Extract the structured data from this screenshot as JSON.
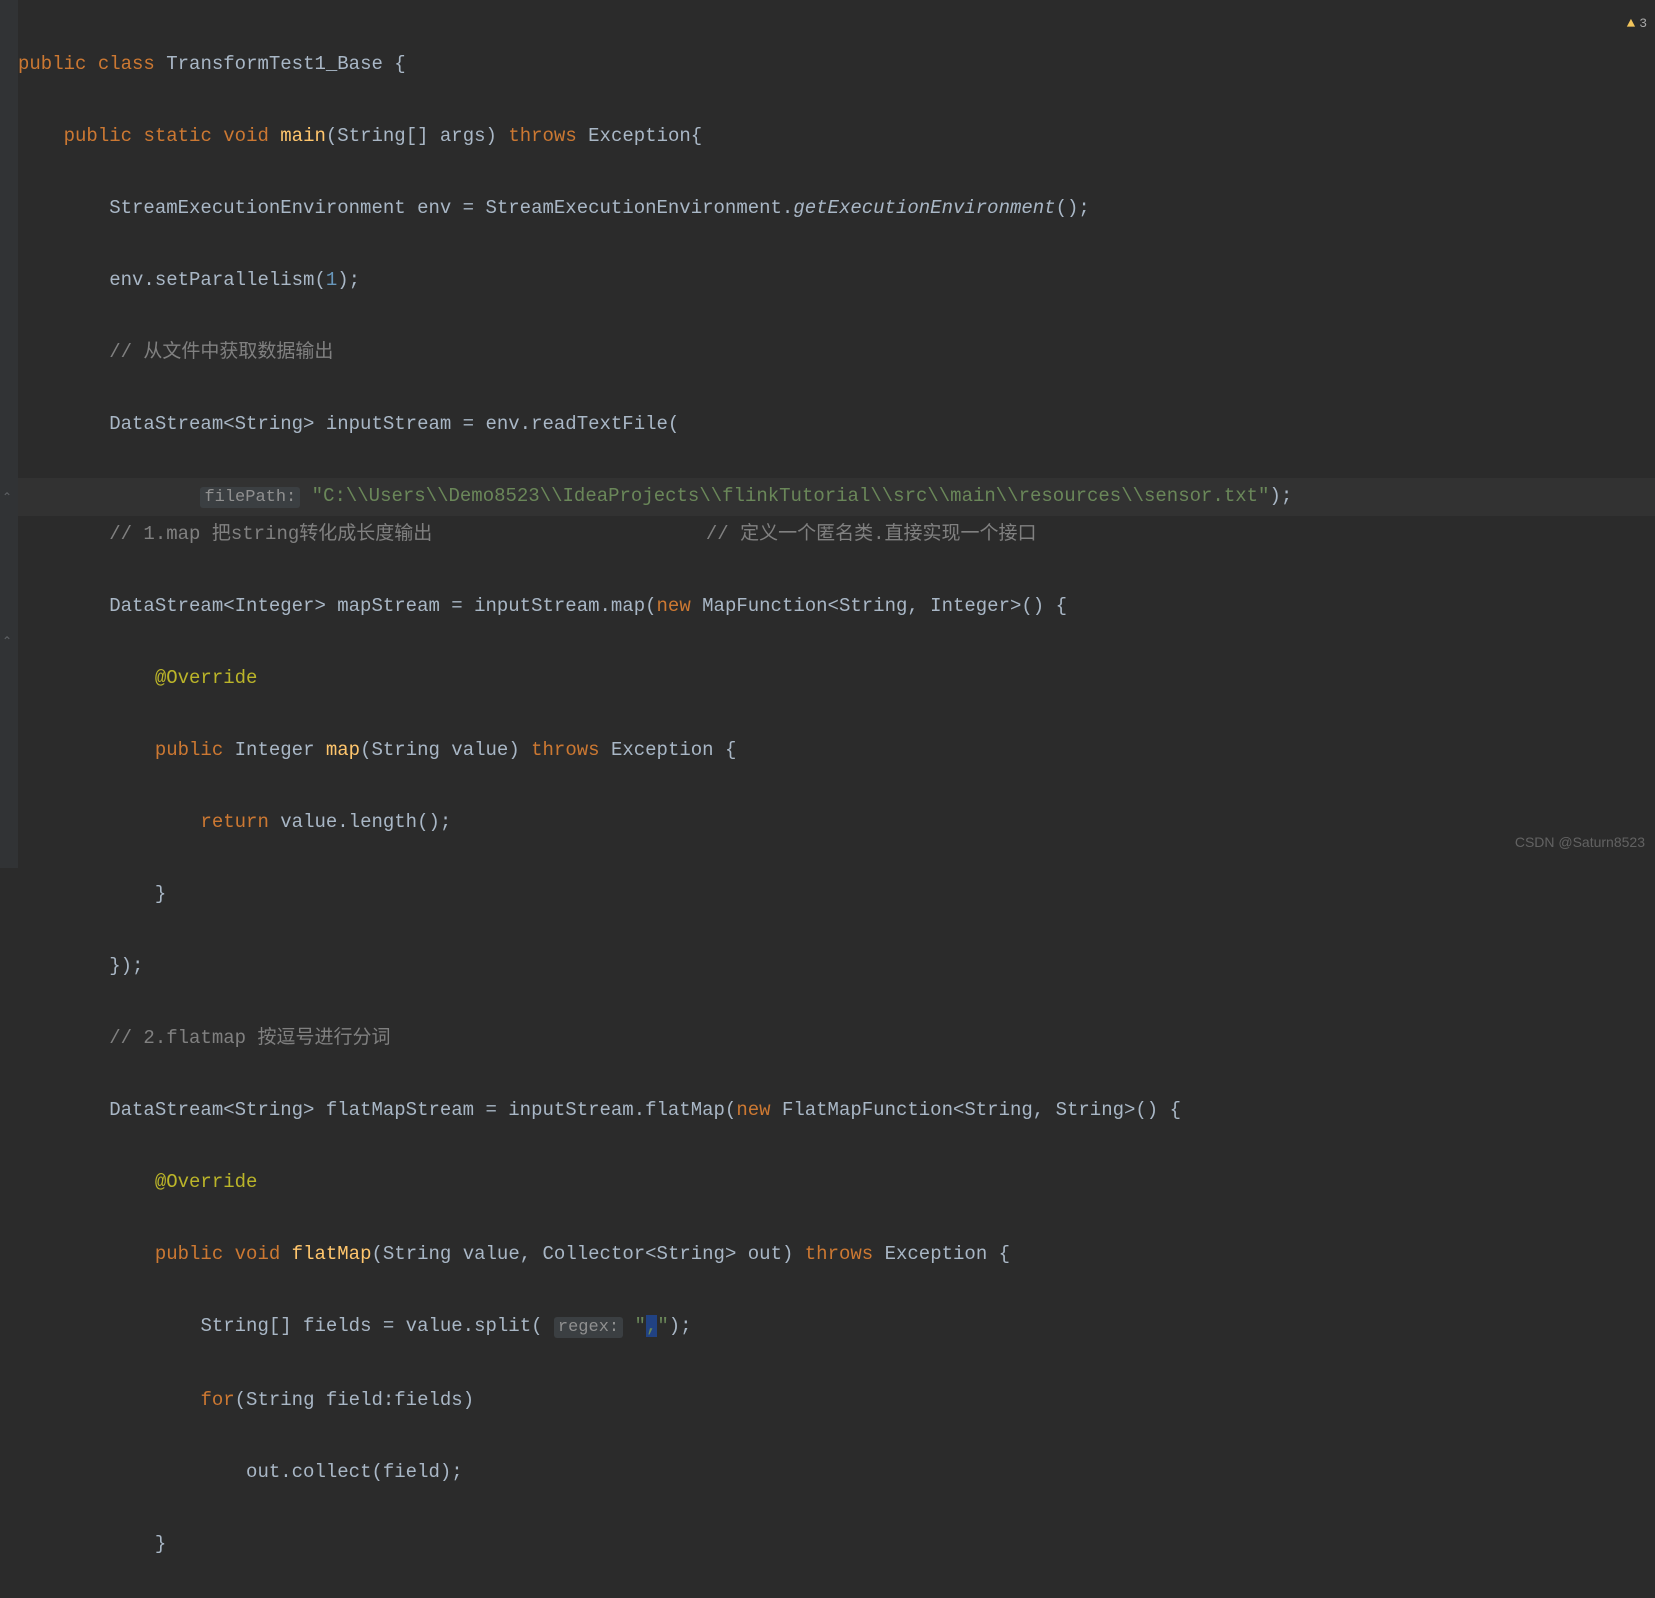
{
  "warnings": {
    "count": "3"
  },
  "watermark": "CSDN @Saturn8523",
  "code": {
    "l1": {
      "kw1": "public",
      "kw2": "class",
      "name": "TransformTest1_Base",
      "brace": "{"
    },
    "l2": {
      "kw1": "public",
      "kw2": "static",
      "kw3": "void",
      "fn": "main",
      "params": "(String[] args)",
      "kw4": "throws",
      "exc": "Exception{"
    },
    "l3": {
      "t1": "StreamExecutionEnvironment env = StreamExecutionEnvironment.",
      "italic": "getExecutionEnvironment",
      "t2": "();"
    },
    "l4": {
      "t1": "env.setParallelism(",
      "num": "1",
      "t2": ");"
    },
    "l5": {
      "c": "// 从文件中获取数据输出"
    },
    "l6": {
      "t": "DataStream<String> inputStream = env.readTextFile("
    },
    "l7": {
      "hint": "filePath:",
      "str": "\"C:\\\\Users\\\\Demo8523\\\\IdeaProjects\\\\flinkTutorial\\\\src\\\\main\\\\resources\\\\sensor.txt\"",
      "end": ");"
    },
    "l8": {
      "c1": "// 1.map 把string转化成长度输出",
      "c2": "// 定义一个匿名类.直接实现一个接口"
    },
    "l9": {
      "t1": "DataStream<Integer> mapStream = inputStream.map(",
      "kw": "new",
      "t2": " MapFunction<String, Integer>() {"
    },
    "l10": {
      "ann": "@Override"
    },
    "l11": {
      "kw1": "public",
      "t1": " Integer ",
      "fn": "map",
      "t2": "(String value) ",
      "kw2": "throws",
      "t3": " Exception {"
    },
    "l12": {
      "kw": "return",
      "t": " value.length();"
    },
    "l13": {
      "t": "}"
    },
    "l14": {
      "t": "});"
    },
    "l15": {
      "c": "// 2.flatmap 按逗号进行分词"
    },
    "l16": {
      "t1": "DataStream<String> flatMapStream = inputStream.flatMap(",
      "kw": "new",
      "t2": " FlatMapFunction<String, String>() {"
    },
    "l17": {
      "ann": "@Override"
    },
    "l18": {
      "kw1": "public",
      "kw2": "void",
      "fn": "flatMap",
      "t1": "(String value, Collector<String> out) ",
      "kw3": "throws",
      "t2": " Exception {"
    },
    "l19": {
      "t1": "String[] fields = value.split( ",
      "hint": "regex:",
      "str1": " \"",
      "sel": ",",
      "str2": "\"",
      "end": ");"
    },
    "l20": {
      "kw": "for",
      "t": "(String field:fields)"
    },
    "l21": {
      "t": "out.collect(field);"
    },
    "l22": {
      "t": "}"
    }
  }
}
